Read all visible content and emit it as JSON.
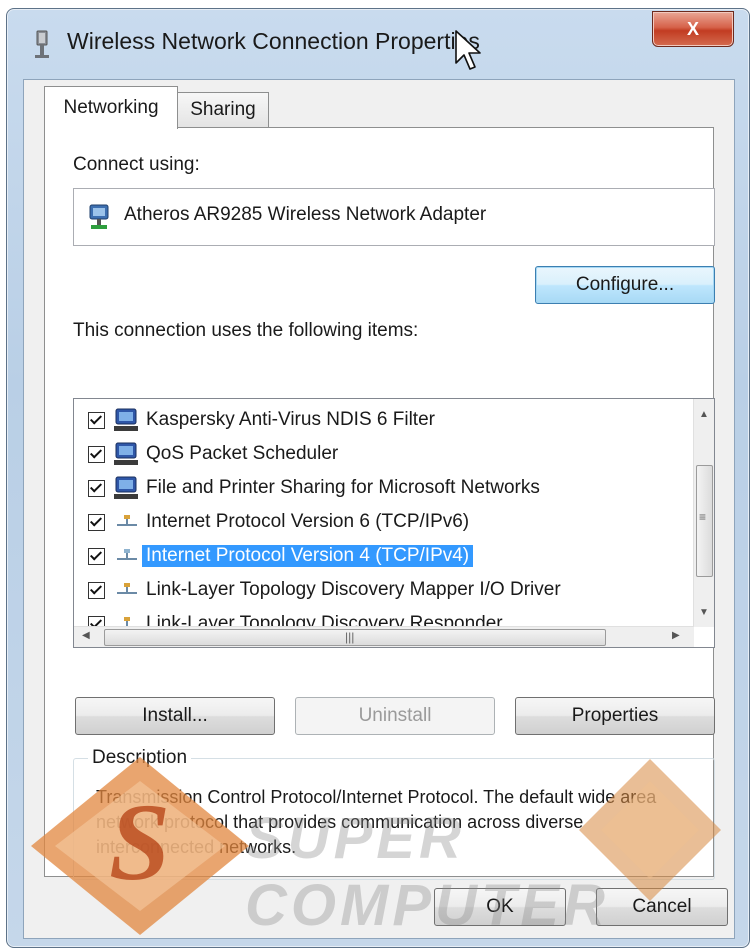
{
  "window": {
    "title": "Wireless Network Connection Properties",
    "close_label": "X"
  },
  "tabs": [
    {
      "label": "Networking",
      "active": true
    },
    {
      "label": "Sharing",
      "active": false
    }
  ],
  "connect": {
    "label": "Connect using:",
    "adapter": "Atheros AR9285 Wireless Network Adapter",
    "configure_label": "Configure..."
  },
  "items": {
    "label": "This connection uses the following items:",
    "list": [
      {
        "label": "Kaspersky Anti-Virus NDIS 6 Filter",
        "checked": true,
        "icon": "network-client-icon"
      },
      {
        "label": "QoS Packet Scheduler",
        "checked": true,
        "icon": "network-client-icon"
      },
      {
        "label": "File and Printer Sharing for Microsoft Networks",
        "checked": true,
        "icon": "network-client-icon"
      },
      {
        "label": "Internet Protocol Version 6 (TCP/IPv6)",
        "checked": true,
        "icon": "protocol-icon"
      },
      {
        "label": "Internet Protocol Version 4 (TCP/IPv4)",
        "checked": true,
        "icon": "protocol-icon",
        "selected": true
      },
      {
        "label": "Link-Layer Topology Discovery Mapper I/O Driver",
        "checked": true,
        "icon": "protocol-icon"
      },
      {
        "label": "Link-Layer Topology Discovery Responder",
        "checked": true,
        "icon": "protocol-icon"
      }
    ]
  },
  "buttons": {
    "install": "Install...",
    "uninstall": "Uninstall",
    "properties": "Properties",
    "ok": "OK",
    "cancel": "Cancel"
  },
  "description": {
    "title": "Description",
    "text": "Transmission Control Protocol/Internet Protocol. The default wide area network protocol that provides communication across diverse interconnected networks."
  },
  "watermark": {
    "text": "SUPER COMPUTER",
    "letter": "S"
  },
  "colors": {
    "selection": "#3399ff",
    "close": "#c9452b",
    "watermark_orange": "#e2873f"
  }
}
